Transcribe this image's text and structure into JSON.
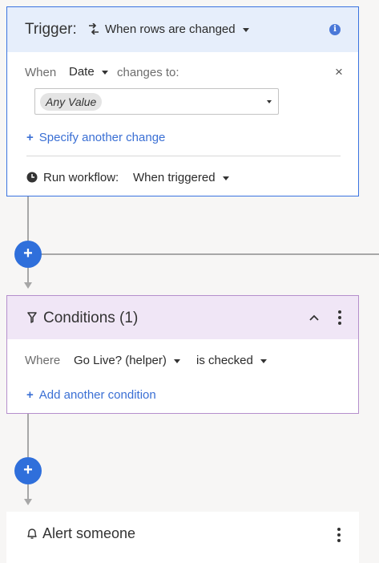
{
  "trigger": {
    "label": "Trigger:",
    "event": "When rows are changed",
    "when_label": "When",
    "field": "Date",
    "changes_to_label": "changes to:",
    "value_chip": "Any Value",
    "add_change": "Specify another change",
    "run_label": "Run workflow:",
    "run_value": "When triggered"
  },
  "conditions": {
    "title": "Conditions (1)",
    "where_label": "Where",
    "field": "Go Live? (helper)",
    "operator": "is checked",
    "add_condition": "Add another condition"
  },
  "alert": {
    "title": "Alert someone"
  },
  "colors": {
    "accent": "#2f6fdb",
    "trigger_border": "#3a73e0",
    "trigger_header": "#e6eefb",
    "condition_border": "#b58fcc",
    "condition_header": "#f0e6f6"
  }
}
